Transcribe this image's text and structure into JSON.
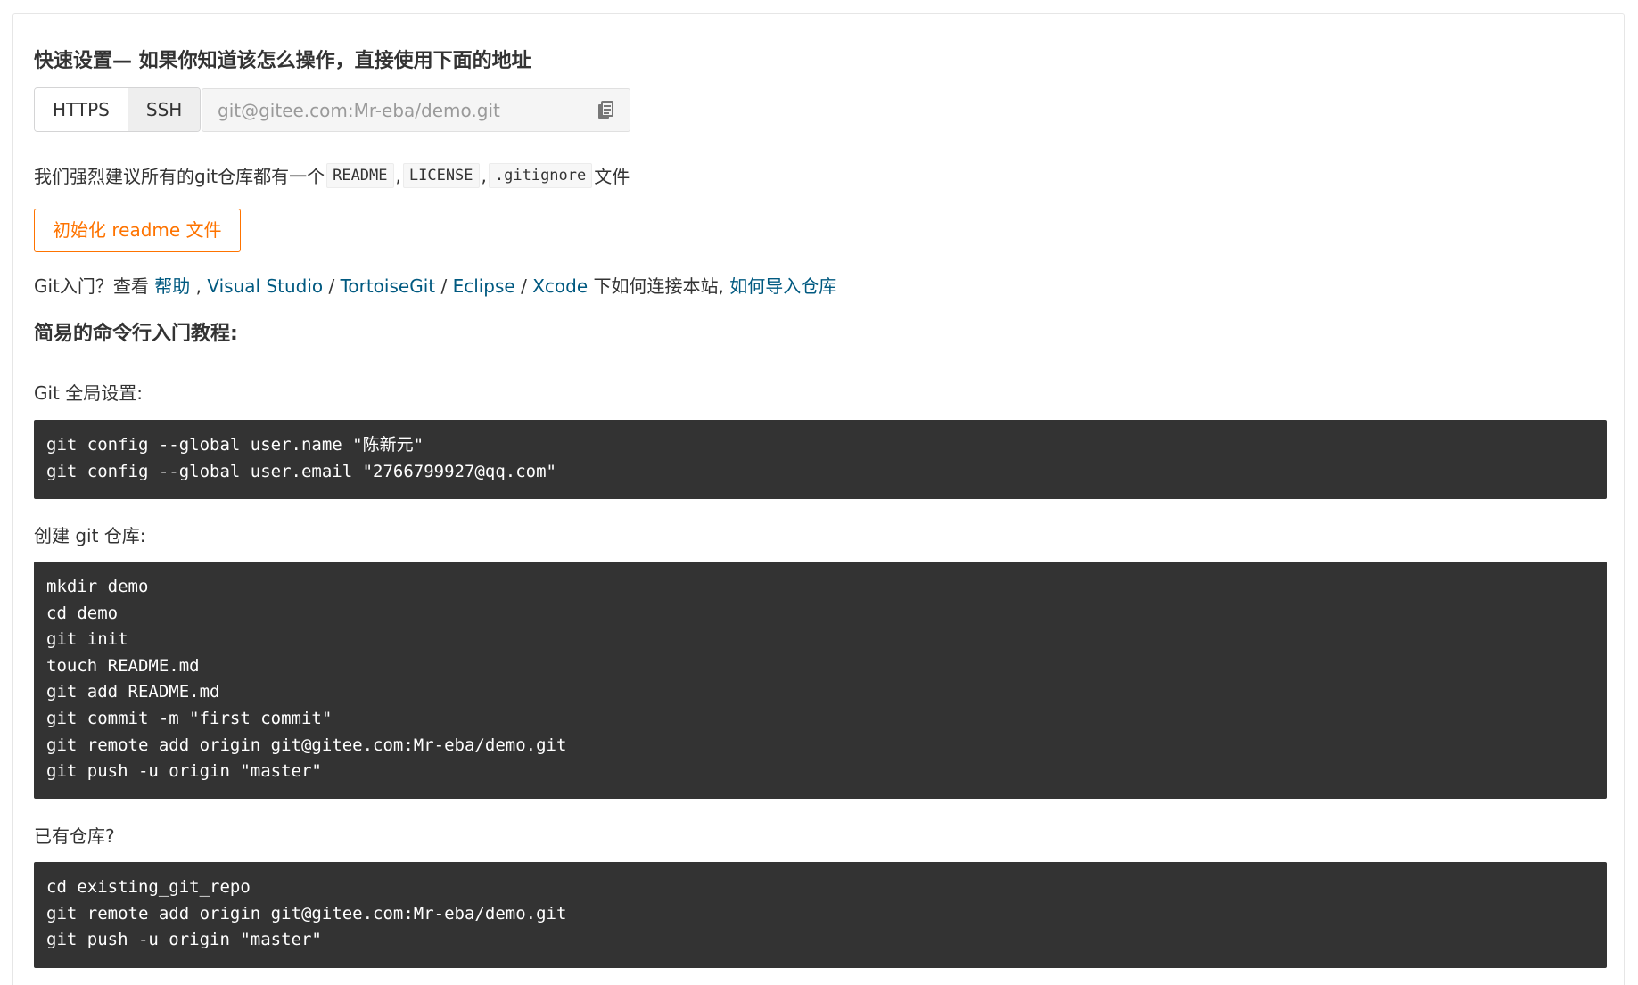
{
  "quick_setup": {
    "heading": "快速设置— 如果你知道该怎么操作，直接使用下面的地址",
    "protocols": [
      "HTTPS",
      "SSH"
    ],
    "url": "git@gitee.com:Mr-eba/demo.git",
    "copy_icon": "copy-icon"
  },
  "recommend": {
    "prefix": "我们强烈建议所有的git仓库都有一个",
    "files": [
      "README",
      "LICENSE",
      ".gitignore"
    ],
    "separator": ",",
    "suffix": "文件"
  },
  "init_button": "初始化 readme 文件",
  "intro": {
    "prefix": "Git入门？查看 ",
    "help": "帮助",
    "sep1": " , ",
    "vs": "Visual Studio",
    "slash": " / ",
    "tortoise": "TortoiseGit",
    "eclipse": "Eclipse",
    "xcode": "Xcode",
    "middle": " 下如何连接本站, ",
    "import": "如何导入仓库"
  },
  "tutorial": {
    "heading": "简易的命令行入门教程:",
    "global_label": "Git 全局设置:",
    "global_code": [
      "git config --global user.name \"陈新元\"",
      "git config --global user.email \"2766799927@qq.com\""
    ],
    "create_label": "创建 git 仓库:",
    "create_code": [
      "mkdir demo",
      "cd demo",
      "git init",
      "touch README.md",
      "git add README.md",
      "git commit -m \"first commit\"",
      "git remote add origin git@gitee.com:Mr-eba/demo.git",
      "git push -u origin \"master\""
    ],
    "existing_label": "已有仓库?",
    "existing_code": [
      "cd existing_git_repo",
      "git remote add origin git@gitee.com:Mr-eba/demo.git",
      "git push -u origin \"master\""
    ]
  }
}
